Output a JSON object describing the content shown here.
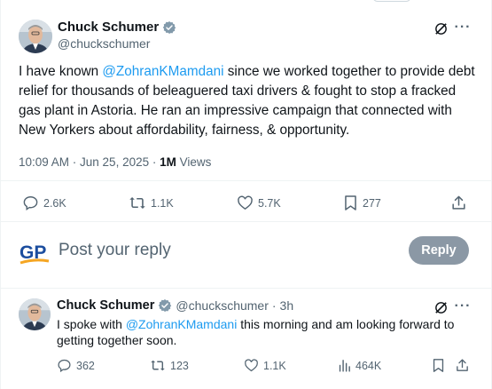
{
  "tweet": {
    "author": {
      "name": "Chuck Schumer",
      "handle": "@chuckschumer"
    },
    "text_before": "I have known ",
    "mention": "@ZohranKMamdani",
    "text_after": " since we worked together to provide debt relief for thousands of beleaguered taxi drivers & fought to stop a fracked gas plant in Astoria. He ran an impressive campaign that connected with New Yorkers about affordability, fairness, & opportunity.",
    "time": "10:09 AM · Jun 25, 2025 · ",
    "views_count": "1M",
    "views_label": " Views",
    "stats": {
      "replies": "2.6K",
      "reposts": "1.1K",
      "likes": "5.7K",
      "bookmarks": "277"
    },
    "more_label": "···"
  },
  "composer": {
    "logo": "GP",
    "placeholder": "Post your reply",
    "button": "Reply"
  },
  "reply": {
    "author": {
      "name": "Chuck Schumer",
      "handle": "@chuckschumer"
    },
    "separator": "·",
    "age": "3h",
    "text_before": "I spoke with ",
    "mention": "@ZohranKMamdani",
    "text_after": " this morning and am looking forward to getting together soon.",
    "stats": {
      "replies": "362",
      "reposts": "123",
      "likes": "1.1K",
      "views": "464K"
    },
    "more_label": "···"
  },
  "colors": {
    "accent": "#1d9bf0",
    "muted": "#536471",
    "verified": "#829aab",
    "reply_button": "#8b98a5",
    "gp_blue": "#1b4d9e",
    "gp_orange": "#f5a623"
  }
}
